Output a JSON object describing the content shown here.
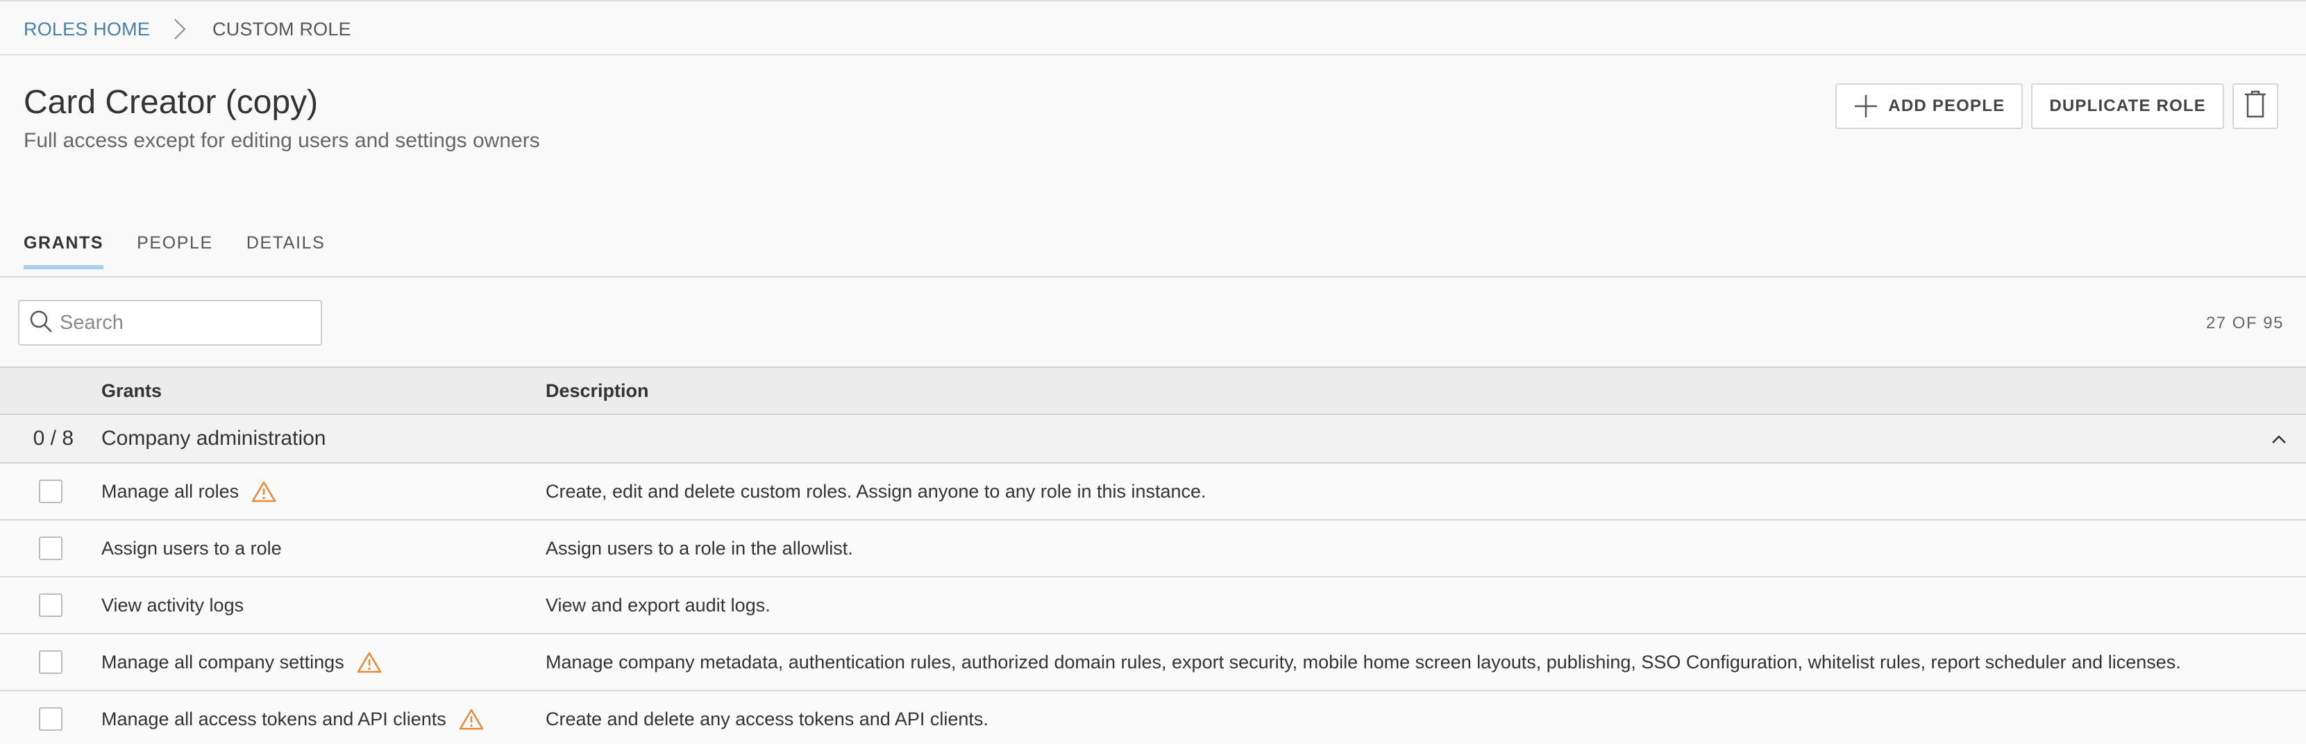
{
  "breadcrumb": {
    "home": "ROLES HOME",
    "current": "CUSTOM ROLE"
  },
  "role": {
    "title": "Card Creator (copy)",
    "subtitle": "Full access except for editing users and settings owners"
  },
  "actions": {
    "add_people": "ADD PEOPLE",
    "duplicate_role": "DUPLICATE ROLE",
    "delete_icon": "trash-icon"
  },
  "tabs": [
    {
      "label": "GRANTS",
      "active": true
    },
    {
      "label": "PEOPLE",
      "active": false
    },
    {
      "label": "DETAILS",
      "active": false
    }
  ],
  "search": {
    "placeholder": "Search",
    "value": ""
  },
  "count": "27 OF 95",
  "table": {
    "headers": {
      "grants": "Grants",
      "description": "Description"
    },
    "group": {
      "count": "0 / 8",
      "name": "Company administration",
      "expanded": true
    },
    "rows": [
      {
        "grant": "Manage all roles",
        "warning": true,
        "description": "Create, edit and delete custom roles. Assign anyone to any role in this instance.",
        "checked": false
      },
      {
        "grant": "Assign users to a role",
        "warning": false,
        "description": "Assign users to a role in the allowlist.",
        "checked": false
      },
      {
        "grant": "View activity logs",
        "warning": false,
        "description": "View and export audit logs.",
        "checked": false
      },
      {
        "grant": "Manage all company settings",
        "warning": true,
        "description": "Manage company metadata, authentication rules, authorized domain rules, export security, mobile home screen layouts, publishing, SSO Configuration, whitelist rules, report scheduler and licenses.",
        "checked": false
      },
      {
        "grant": "Manage all access tokens and API clients",
        "warning": true,
        "description": "Create and delete any access tokens and API clients.",
        "checked": false
      }
    ]
  },
  "colors": {
    "link": "#4a7fab",
    "tab_underline": "#a9cfee",
    "warning": "#e8893a"
  }
}
